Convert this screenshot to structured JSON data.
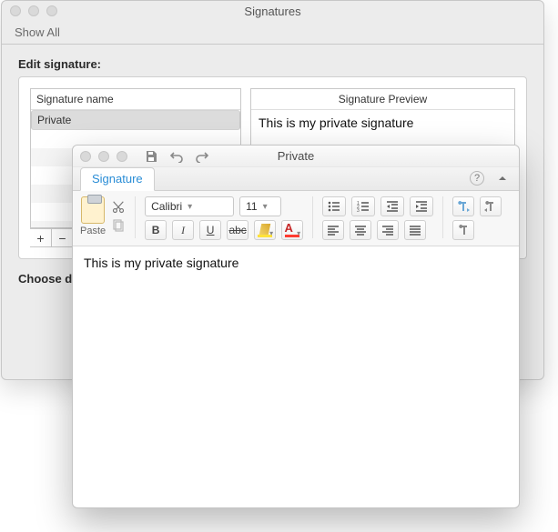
{
  "back": {
    "title": "Signatures",
    "show_all": "Show All",
    "edit_label": "Edit signature:",
    "list_header": "Signature name",
    "rows": [
      "Private"
    ],
    "preview_header": "Signature Preview",
    "preview_text": "This is my private signature",
    "add": "+",
    "remove": "−",
    "choose_label": "Choose d"
  },
  "front": {
    "title": "Private",
    "tab": "Signature",
    "paste_label": "Paste",
    "font_name": "Calibri",
    "font_size": "11",
    "bold": "B",
    "italic": "I",
    "underline": "U",
    "strike": "abc",
    "fontcolor_letter": "A",
    "editor_text": "This is my private signature"
  }
}
